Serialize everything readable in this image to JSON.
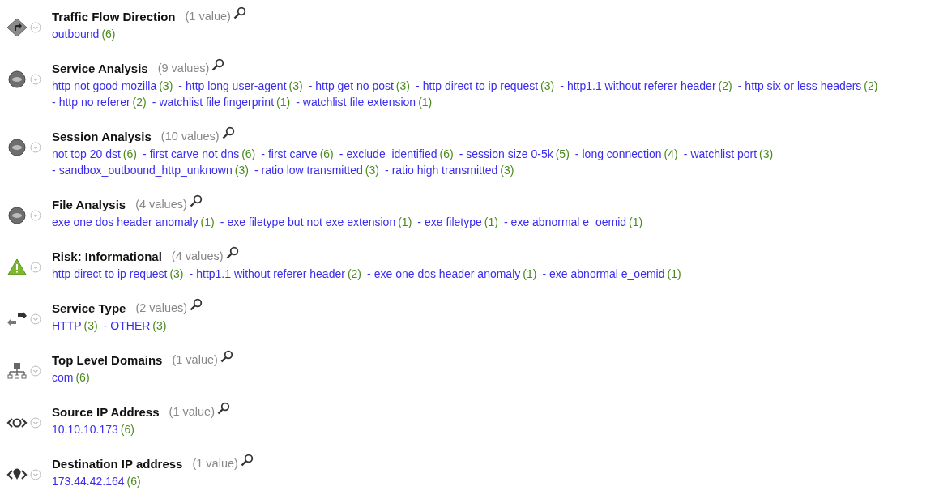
{
  "separator": "-",
  "groups": [
    {
      "title": "Traffic Flow Direction",
      "count": "(1 value)",
      "kind": "direction",
      "values": [
        {
          "label": "outbound",
          "count": "(6)"
        }
      ]
    },
    {
      "title": "Service Analysis",
      "count": "(9 values)",
      "kind": "service",
      "values": [
        {
          "label": "http not good mozilla",
          "count": "(3)"
        },
        {
          "label": "http long user-agent",
          "count": "(3)"
        },
        {
          "label": "http get no post",
          "count": "(3)"
        },
        {
          "label": "http direct to ip request",
          "count": "(3)"
        },
        {
          "label": "http1.1 without referer header",
          "count": "(2)"
        },
        {
          "label": "http six or less headers",
          "count": "(2)"
        },
        {
          "label": "http no referer",
          "count": "(2)"
        },
        {
          "label": "watchlist file fingerprint",
          "count": "(1)"
        },
        {
          "label": "watchlist file extension",
          "count": "(1)"
        }
      ]
    },
    {
      "title": "Session Analysis",
      "count": "(10 values)",
      "kind": "service",
      "values": [
        {
          "label": "not top 20 dst",
          "count": "(6)"
        },
        {
          "label": "first carve not dns",
          "count": "(6)"
        },
        {
          "label": "first carve",
          "count": "(6)"
        },
        {
          "label": "exclude_identified",
          "count": "(6)"
        },
        {
          "label": "session size 0-5k",
          "count": "(5)"
        },
        {
          "label": "long connection",
          "count": "(4)"
        },
        {
          "label": "watchlist port",
          "count": "(3)"
        },
        {
          "label": "sandbox_outbound_http_unknown",
          "count": "(3)"
        },
        {
          "label": "ratio low transmitted",
          "count": "(3)"
        },
        {
          "label": "ratio high transmitted",
          "count": "(3)"
        }
      ]
    },
    {
      "title": "File Analysis",
      "count": "(4 values)",
      "kind": "service",
      "values": [
        {
          "label": "exe one dos header anomaly",
          "count": "(1)"
        },
        {
          "label": "exe filetype but not exe extension",
          "count": "(1)"
        },
        {
          "label": "exe filetype",
          "count": "(1)"
        },
        {
          "label": "exe abnormal e_oemid",
          "count": "(1)"
        }
      ]
    },
    {
      "title": "Risk: Informational",
      "count": "(4 values)",
      "kind": "warning",
      "values": [
        {
          "label": "http direct to ip request",
          "count": "(3)"
        },
        {
          "label": "http1.1 without referer header",
          "count": "(2)"
        },
        {
          "label": "exe one dos header anomaly",
          "count": "(1)"
        },
        {
          "label": "exe abnormal e_oemid",
          "count": "(1)"
        }
      ]
    },
    {
      "title": "Service Type",
      "count": "(2 values)",
      "kind": "exchange",
      "values": [
        {
          "label": "HTTP",
          "count": "(3)"
        },
        {
          "label": "OTHER",
          "count": "(3)"
        }
      ]
    },
    {
      "title": "Top Level Domains",
      "count": "(1 value)",
      "kind": "network",
      "values": [
        {
          "label": "com",
          "count": "(6)"
        }
      ]
    },
    {
      "title": "Source IP Address",
      "count": "(1 value)",
      "kind": "source-ip",
      "values": [
        {
          "label": "10.10.10.173",
          "count": "(6)"
        }
      ]
    },
    {
      "title": "Destination IP address",
      "count": "(1 value)",
      "kind": "dest-ip",
      "values": [
        {
          "label": "173.44.42.164",
          "count": "(6)"
        }
      ]
    }
  ]
}
